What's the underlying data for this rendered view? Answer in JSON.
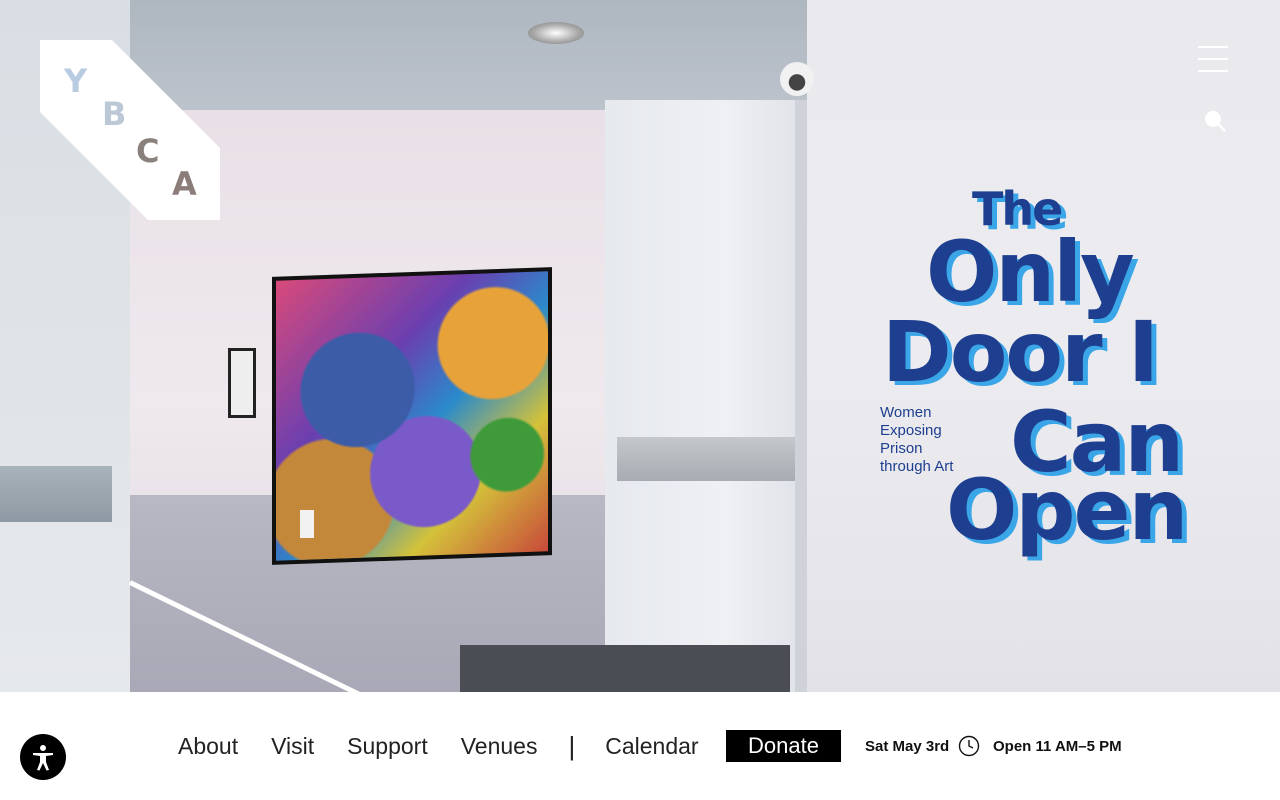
{
  "brand": {
    "logo_letters": [
      "Y",
      "B",
      "C",
      "A"
    ]
  },
  "hero": {
    "exhibition_title_lines": [
      "The",
      "Only",
      "Door I",
      "Can",
      "Open"
    ],
    "exhibition_subtitle": "Women Exposing Prison through Art"
  },
  "header": {
    "menu_icon": "hamburger-icon",
    "search_icon": "search-icon"
  },
  "nav": {
    "items": [
      "About",
      "Visit",
      "Support",
      "Venues"
    ],
    "separator": "|",
    "calendar": "Calendar",
    "donate": "Donate"
  },
  "status": {
    "date": "Sat May 3rd",
    "clock_icon": "clock-icon",
    "hours": "Open 11 AM–5 PM"
  },
  "accessibility": {
    "icon": "accessibility-icon"
  },
  "colors": {
    "title_navy": "#1e3f8f",
    "title_cyan": "#3aa6e8",
    "donate_bg": "#000000"
  }
}
